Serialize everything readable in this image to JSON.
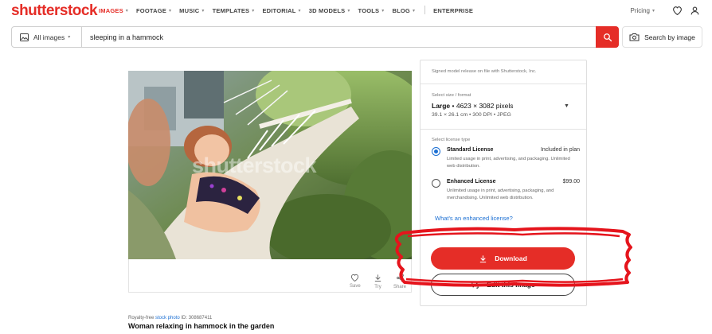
{
  "nav": {
    "logo": "shutterstock",
    "links": [
      {
        "label": "IMAGES",
        "active": true,
        "caret": true
      },
      {
        "label": "FOOTAGE",
        "active": false,
        "caret": true
      },
      {
        "label": "MUSIC",
        "active": false,
        "caret": true
      },
      {
        "label": "TEMPLATES",
        "active": false,
        "caret": true
      },
      {
        "label": "EDITORIAL",
        "active": false,
        "caret": true
      },
      {
        "label": "3D MODELS",
        "active": false,
        "caret": true
      },
      {
        "label": "TOOLS",
        "active": false,
        "caret": true
      },
      {
        "label": "BLOG",
        "active": false,
        "caret": true
      },
      {
        "label": "ENTERPRISE",
        "active": false,
        "caret": false
      }
    ],
    "pricing_label": "Pricing",
    "heart_icon": "heart-icon",
    "account_icon": "account-icon"
  },
  "search": {
    "type_label": "All images",
    "query": "sleeping in a hammock",
    "by_image_label": "Search by image"
  },
  "photo": {
    "watermark": "shutterstock",
    "actions": [
      {
        "label": "Save",
        "icon": "heart-icon"
      },
      {
        "label": "Try",
        "icon": "download-icon"
      },
      {
        "label": "Share",
        "icon": "share-icon"
      }
    ]
  },
  "caption": {
    "prefix": "Royalty-free",
    "link": "stock photo",
    "id_text": "ID: 308687411",
    "title": "Woman relaxing in hammock in the garden"
  },
  "panel": {
    "release_text": "Signed model release on file with Shutterstock, Inc.",
    "size_label": "Select size / format",
    "size_name": "Large",
    "size_dims": " • 4623 × 3082 pixels",
    "size_detail": "39.1 × 26.1 cm • 300 DPI • JPEG",
    "license_label": "Select license type",
    "licenses": [
      {
        "name": "Standard License",
        "price": "Included in plan",
        "desc": "Limited usage in print, advertising, and packaging. Unlimited web distribution.",
        "selected": true
      },
      {
        "name": "Enhanced License",
        "price": "$99.00",
        "desc": "Unlimited usage in print, advertising, packaging, and merchandising. Unlimited web distribution.",
        "selected": false
      }
    ],
    "enhanced_link": "What's an enhanced license?",
    "download_label": "Download",
    "edit_label": "Edit this image"
  },
  "colors": {
    "brand_red": "#e52d27",
    "link_blue": "#1b6fd3",
    "annotation_red": "#e5141c"
  }
}
